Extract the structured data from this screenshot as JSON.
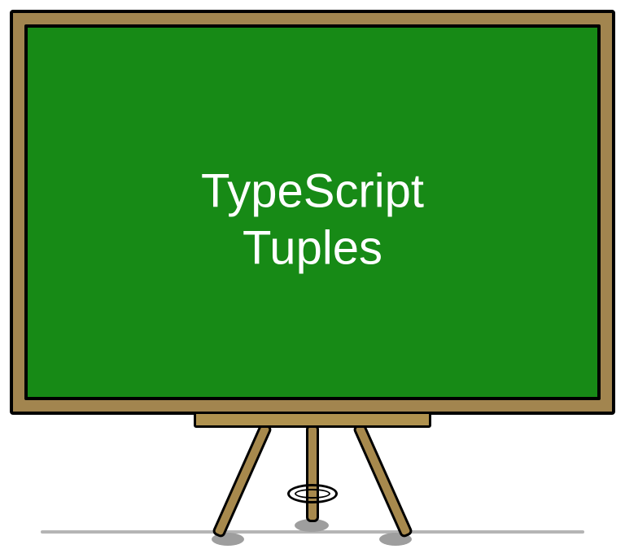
{
  "board": {
    "title": "TypeScript\nTuples"
  },
  "colors": {
    "frame": "#a2854f",
    "surface": "#178a16",
    "text": "#ffffff"
  }
}
